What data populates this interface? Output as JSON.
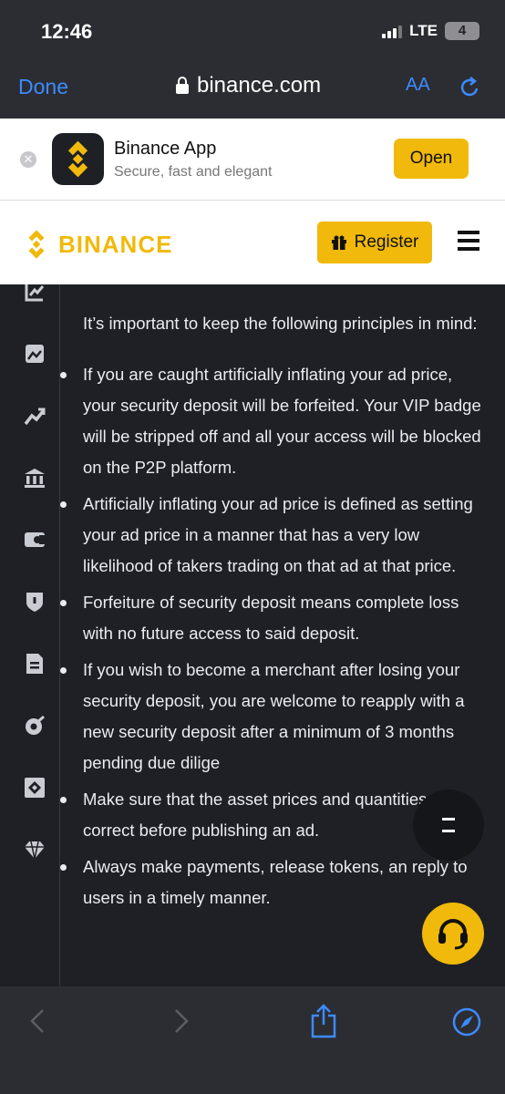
{
  "status_bar": {
    "time": "12:46",
    "network": "LTE",
    "battery": "4"
  },
  "nav": {
    "done_label": "Done",
    "url": "binance.com",
    "text_size_label": "AA"
  },
  "app_banner": {
    "title": "Binance App",
    "subtitle": "Secure, fast and elegant",
    "open_label": "Open"
  },
  "header": {
    "brand": "BINANCE",
    "register_label": "Register"
  },
  "article": {
    "intro": "It’s important to keep the following principles in mind:",
    "bullets": [
      "If you are caught artificially inflating your ad price, your security deposit will be forfeited. Your VIP badge will be stripped off and all your access will be blocked on the P2P platform.",
      "Artificially inflating your ad price is defined as setting your ad price in a manner that has a very low likelihood of takers trading on that ad at that price.",
      "Forfeiture of security deposit means complete loss with no future access to said deposit.",
      "If you wish to become a merchant after losing your security deposit, you are welcome to reapply with a new security deposit after a minimum of 3 months pending due dilige",
      "Make sure that the asset prices and quantities are correct before publishing an ad.",
      "Always make payments, release tokens, an reply to users in a timely manner."
    ]
  },
  "icons": [
    "chart-icon",
    "image-icon",
    "trend-icon",
    "bank-icon",
    "card-icon",
    "shield-icon",
    "document-icon",
    "target-icon",
    "grid-icon",
    "diamond-icon"
  ],
  "colors": {
    "brand": "#F0B90B",
    "dark": "#1E2026",
    "ios_blue": "#3D8BFD"
  }
}
